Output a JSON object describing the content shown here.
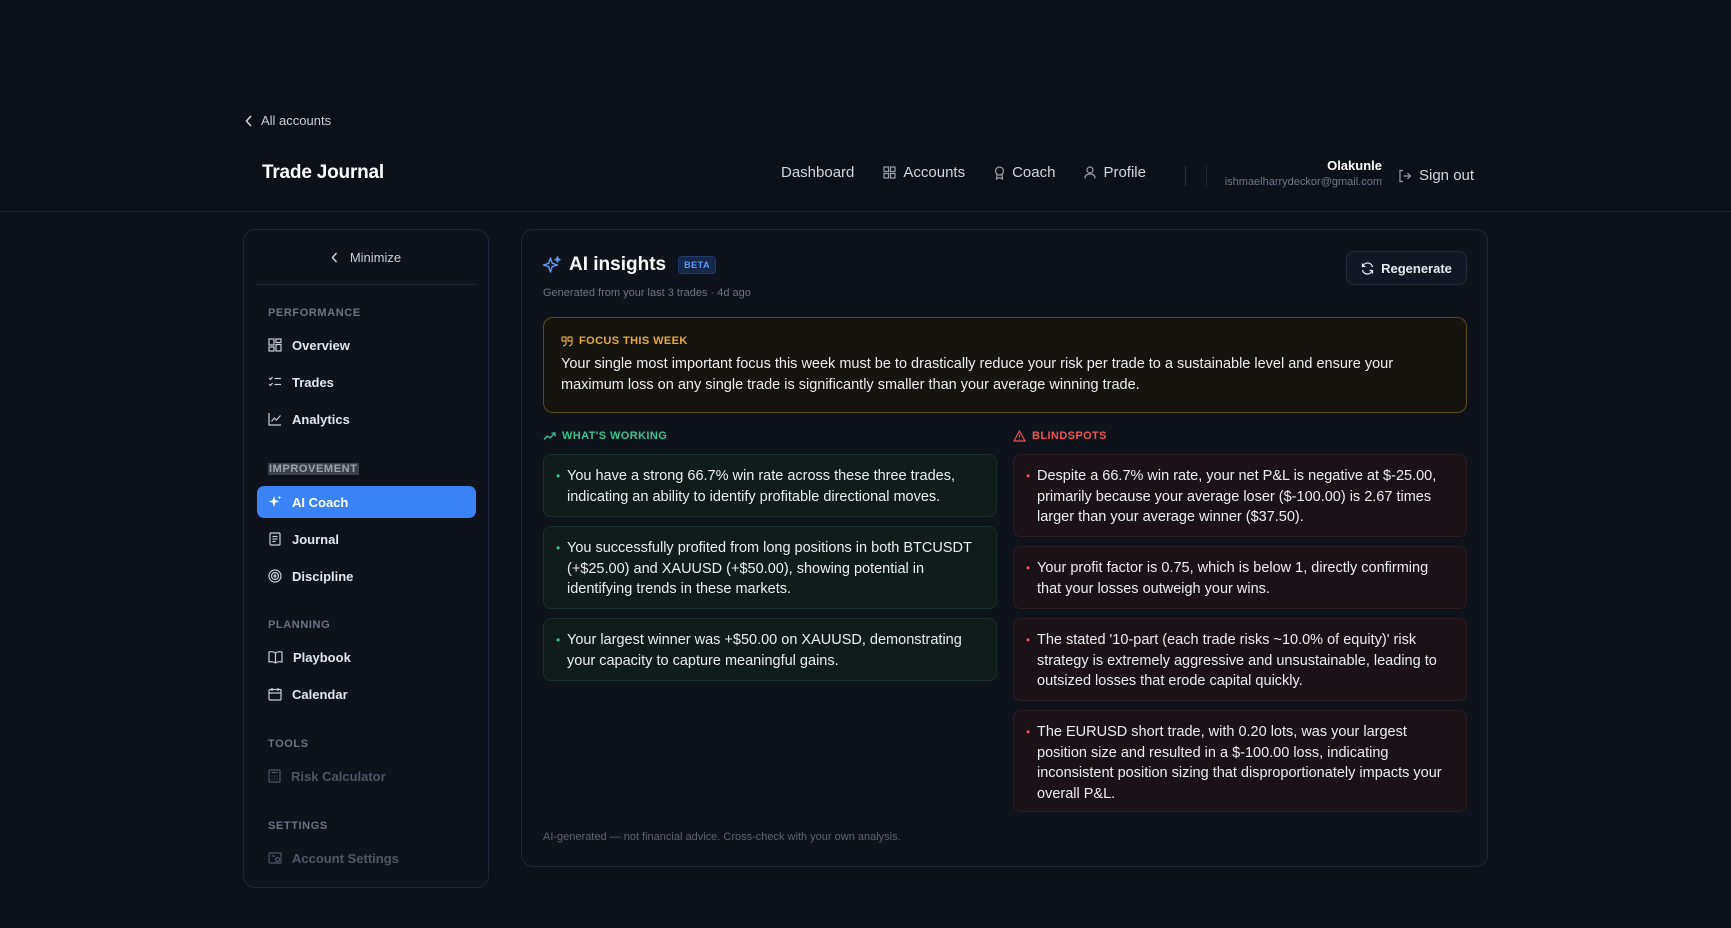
{
  "back_link": {
    "label": "All accounts"
  },
  "brand": {
    "name": "Trade Journal"
  },
  "nav": {
    "dashboard": "Dashboard",
    "accounts": "Accounts",
    "coach": "Coach",
    "profile": "Profile"
  },
  "user": {
    "name": "Olakunle",
    "email": "ishmaelharrydeckor@gmail.com",
    "signout": "Sign out"
  },
  "sidebar": {
    "minimize": "Minimize",
    "sections": {
      "performance": "PERFORMANCE",
      "improvement": "IMPROVEMENT",
      "planning": "PLANNING",
      "tools": "TOOLS",
      "settings": "SETTINGS"
    },
    "items": {
      "overview": "Overview",
      "trades": "Trades",
      "analytics": "Analytics",
      "ai_coach": "AI Coach",
      "journal": "Journal",
      "discipline": "Discipline",
      "playbook": "Playbook",
      "calendar": "Calendar",
      "risk_calculator": "Risk Calculator",
      "account_settings": "Account Settings"
    },
    "active_item": "ai_coach"
  },
  "insights": {
    "title": "AI insights",
    "badge": "BETA",
    "subtitle": "Generated from your last 3 trades · 4d ago",
    "regenerate": "Regenerate",
    "focus": {
      "label": "FOCUS THIS WEEK",
      "text": "Your single most important focus this week must be to drastically reduce your risk per trade to a sustainable level and ensure your maximum loss on any single trade is significantly smaller than your average winning trade."
    },
    "working": {
      "label": "WHAT'S WORKING",
      "items": [
        "You have a strong 66.7% win rate across these three trades, indicating an ability to identify profitable directional moves.",
        "You successfully profited from long positions in both BTCUSDT (+$25.00) and XAUUSD (+$50.00), showing potential in identifying trends in these markets.",
        "Your largest winner was +$50.00 on XAUUSD, demonstrating your capacity to capture meaningful gains."
      ]
    },
    "blindspots": {
      "label": "BLINDSPOTS",
      "items": [
        "Despite a 66.7% win rate, your net P&L is negative at $-25.00, primarily because your average loser ($-100.00) is 2.67 times larger than your average winner ($37.50).",
        "Your profit factor is 0.75, which is below 1, directly confirming that your losses outweigh your wins.",
        "The stated '10-part (each trade risks ~10.0% of equity)' risk strategy is extremely aggressive and unsustainable, leading to outsized losses that erode capital quickly.",
        "The EURUSD short trade, with 0.20 lots, was your largest position size and resulted in a $-100.00 loss, indicating inconsistent position sizing that disproportionately impacts your overall P&L."
      ]
    },
    "disclaimer": "AI-generated — not financial advice. Cross-check with your own analysis."
  },
  "colors": {
    "accent": "#3b82f6",
    "good": "#34c48c",
    "bad": "#ef5350",
    "focus": "#e8a93a"
  }
}
